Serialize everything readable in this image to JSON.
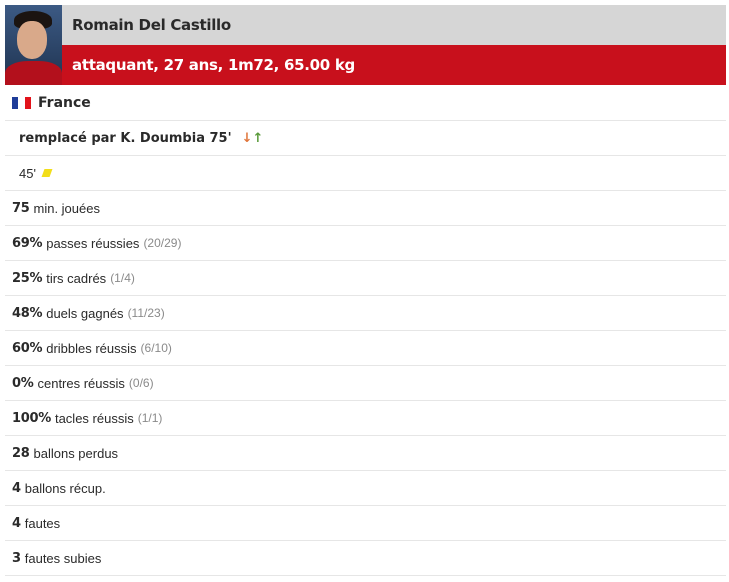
{
  "player": {
    "name": "Romain Del Castillo",
    "info": "attaquant, 27 ans, 1m72, 65.00 kg",
    "nationality": "France",
    "flag_colors": [
      "#1f3d99",
      "#ffffff",
      "#e2131b"
    ]
  },
  "substitution": {
    "text": "remplacé par K. Doumbia 75'",
    "icon": "substitution-arrows-icon",
    "arrow_down": "↓",
    "arrow_up": "↑"
  },
  "booking": {
    "minute": "45'",
    "icon": "yellow-card-icon"
  },
  "stats": [
    {
      "value": "75",
      "label": "min. jouées",
      "detail": ""
    },
    {
      "value": "69%",
      "label": "passes réussies",
      "detail": "(20/29)"
    },
    {
      "value": "25%",
      "label": "tirs cadrés",
      "detail": "(1/4)"
    },
    {
      "value": "48%",
      "label": "duels gagnés",
      "detail": "(11/23)"
    },
    {
      "value": "60%",
      "label": "dribbles réussis",
      "detail": "(6/10)"
    },
    {
      "value": "0%",
      "label": "centres réussis",
      "detail": "(0/6)"
    },
    {
      "value": "100%",
      "label": "tacles réussis",
      "detail": "(1/1)"
    },
    {
      "value": "28",
      "label": "ballons perdus",
      "detail": ""
    },
    {
      "value": "4",
      "label": "ballons récup.",
      "detail": ""
    },
    {
      "value": "4",
      "label": "fautes",
      "detail": ""
    },
    {
      "value": "3",
      "label": "fautes subies",
      "detail": ""
    }
  ],
  "colors": {
    "accent": "#c8101c",
    "name_bar": "#d6d6d6",
    "yellow_card": "#f2de1a"
  }
}
